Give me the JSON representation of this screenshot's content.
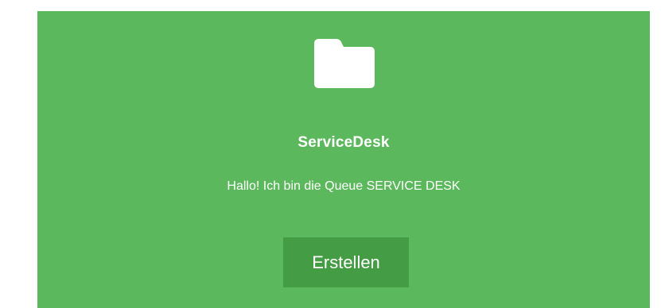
{
  "card": {
    "background_color": "#5cb85c",
    "icon": "folder-icon",
    "title": "ServiceDesk",
    "description": "Hallo! Ich bin die Queue SERVICE DESK",
    "button": {
      "label": "Erstellen",
      "color": "#449d44"
    }
  }
}
